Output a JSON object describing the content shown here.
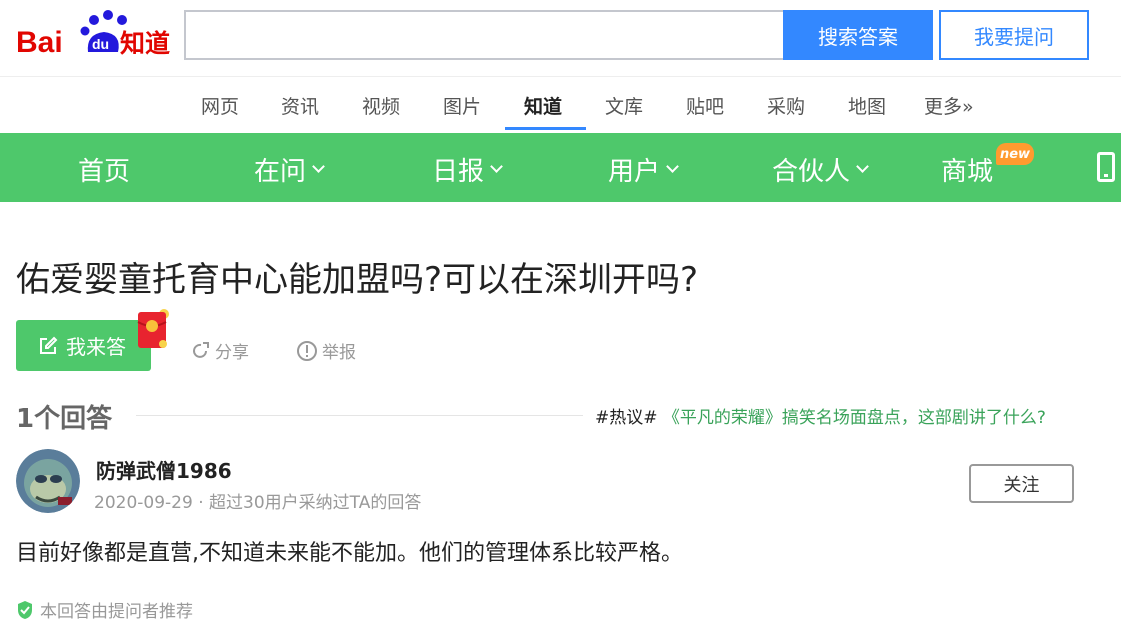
{
  "header": {
    "logo_text": "Baidu知道",
    "search_placeholder": "",
    "search_button": "搜索答案",
    "ask_button": "我要提问"
  },
  "channels": [
    "网页",
    "资讯",
    "视频",
    "图片",
    "知道",
    "文库",
    "贴吧",
    "采购",
    "地图",
    "更多»"
  ],
  "active_channel": "知道",
  "green_nav": {
    "items": [
      "首页",
      "在问",
      "日报",
      "用户",
      "合伙人",
      "商城"
    ],
    "new_badge": "new",
    "background": "#4ec86b"
  },
  "question": {
    "title": "佑爱婴童托育中心能加盟吗?可以在深圳开吗?",
    "answer_button": "我来答",
    "share": "分享",
    "report": "举报"
  },
  "answers_header": {
    "count": "1个回答",
    "hot_tag": "#热议#",
    "hot_link": "《平凡的荣耀》搞笑名场面盘点，这部剧讲了什么?"
  },
  "answer": {
    "username": "防弹武僧1986",
    "meta": "2020-09-29 · 超过30用户采纳过TA的回答",
    "follow": "关注",
    "text": "目前好像都是直营,不知道未来能不能加。他们的管理体系比较严格。",
    "recommend": "本回答由提问者推荐"
  },
  "colors": {
    "accent_blue": "#3388ff",
    "green": "#4ec86b",
    "link_green": "#3aa35a"
  }
}
